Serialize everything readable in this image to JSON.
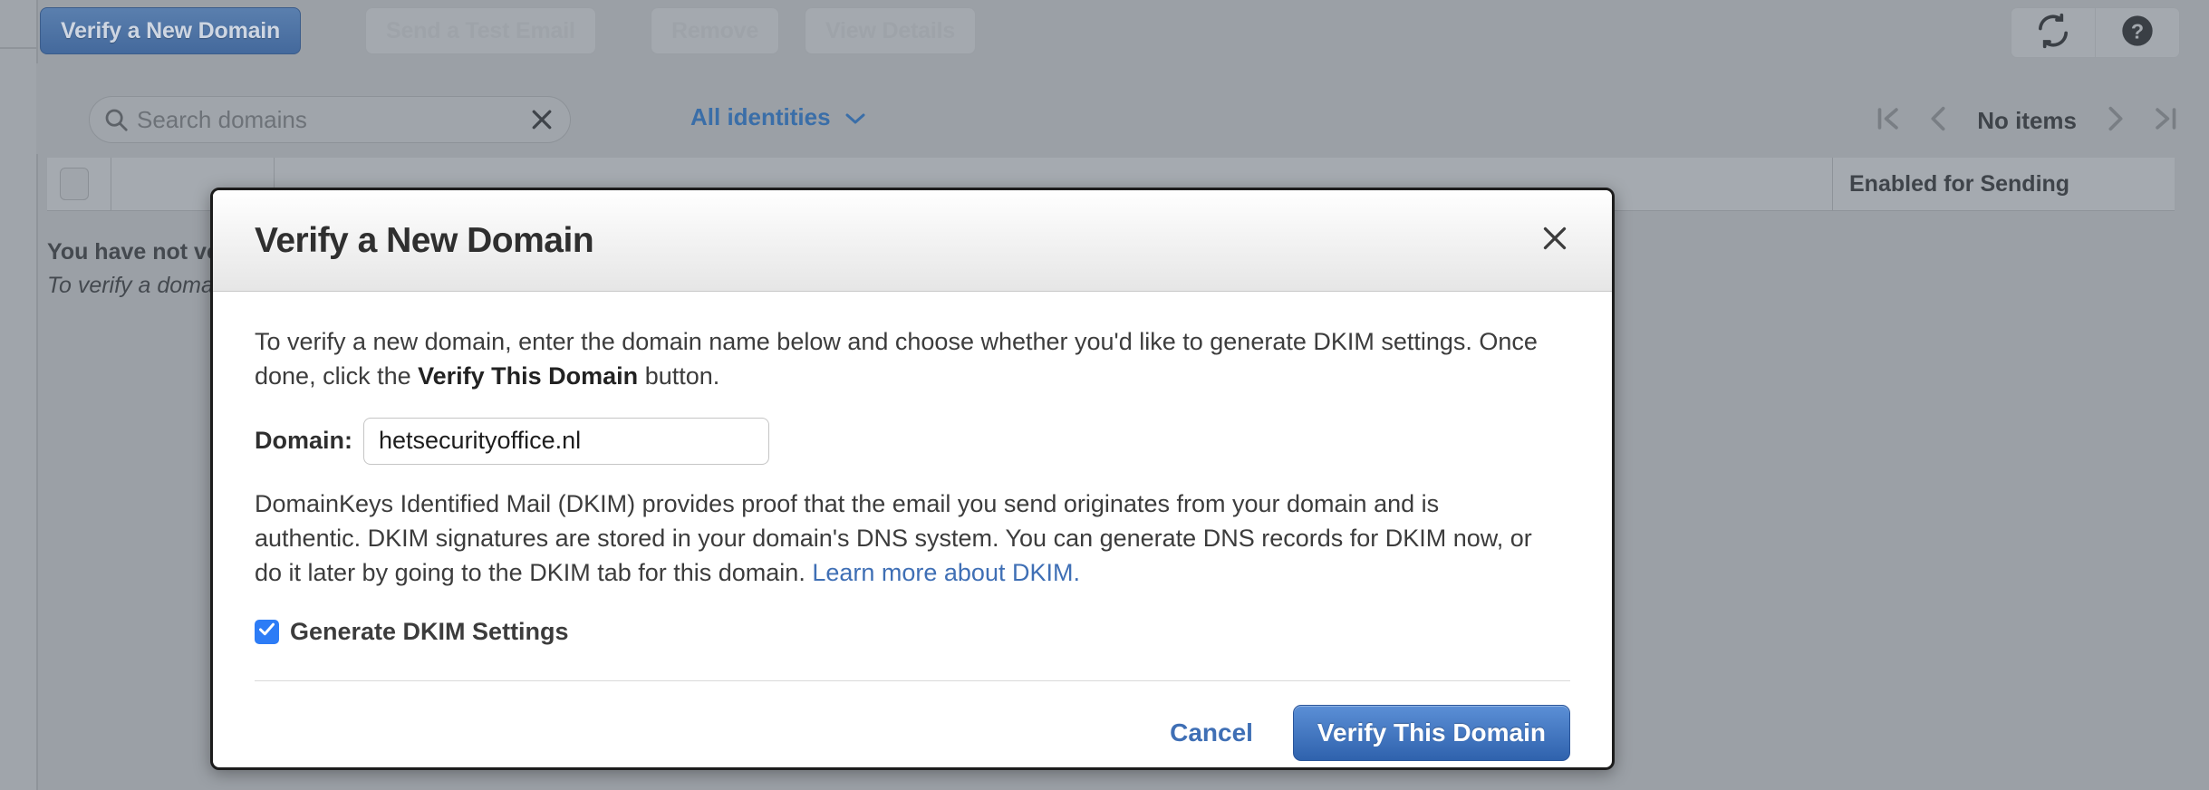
{
  "toolbar": {
    "verify_new_domain": "Verify a New Domain",
    "send_test_email": "Send a Test Email",
    "remove": "Remove",
    "view_details": "View Details",
    "refresh_icon": "refresh-icon",
    "help_icon": "help-circle-icon"
  },
  "filterbar": {
    "search_placeholder": "Search domains",
    "search_value": "",
    "search_icon": "search-icon",
    "clear_icon": "close-x-icon",
    "identities_label": "All identities",
    "identities_caret": "chevron-down-icon"
  },
  "pager": {
    "first_icon": "first-page-icon",
    "prev_icon": "previous-page-icon",
    "label": "No items",
    "next_icon": "next-page-icon",
    "last_icon": "last-page-icon"
  },
  "table": {
    "columns": [
      "",
      "",
      "",
      "Enabled for Sending"
    ]
  },
  "empty_state": {
    "title": "You have not ve",
    "subtitle": "To verify a doma"
  },
  "modal": {
    "title": "Verify a New Domain",
    "close_icon": "close-x-icon",
    "intro_part1": "To verify a new domain, enter the domain name below and choose whether you'd like to generate DKIM settings. Once done, click the ",
    "intro_strong": "Verify This Domain",
    "intro_part2": " button.",
    "domain_label": "Domain:",
    "domain_value": "hetsecurityoffice.nl",
    "domain_placeholder": "",
    "dkim_text": "DomainKeys Identified Mail (DKIM) provides proof that the email you send originates from your domain and is authentic. DKIM signatures are stored in your domain's DNS system. You can generate DNS records for DKIM now, or do it later by going to the DKIM tab for this domain. ",
    "dkim_link": "Learn more about DKIM.",
    "checkbox_label": "Generate DKIM Settings",
    "checkbox_checked": true,
    "cancel_label": "Cancel",
    "submit_label": "Verify This Domain"
  },
  "colors": {
    "page_background": "#9ba0a6",
    "primary_blue": "#2f62ad",
    "link_blue": "#3f6fb5",
    "checkbox_blue": "#2d7cf6",
    "modal_background": "#ffffff"
  }
}
